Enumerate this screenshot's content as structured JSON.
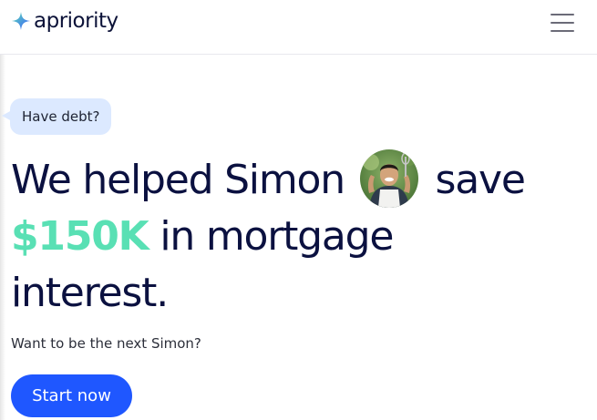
{
  "brand": {
    "name": "apriority",
    "logo_icon": "sparkle-icon",
    "colors": {
      "logo_blue": "#3b82f6",
      "logo_teal": "#5ee0b4"
    }
  },
  "header": {
    "menu_icon": "hamburger-menu-icon"
  },
  "hero": {
    "bubble_text": "Have debt?",
    "headline": {
      "part1": "We helped Simon",
      "part2": "save",
      "amount": "$150K",
      "part3": "in mortgage",
      "part4": "interest."
    },
    "subline": "Want to be the next Simon?",
    "cta_label": "Start now"
  },
  "colors": {
    "text_dark": "#0b1140",
    "accent_green": "#59e0b4",
    "cta_blue": "#1f57ff",
    "bubble_bg": "#dce9ff"
  }
}
